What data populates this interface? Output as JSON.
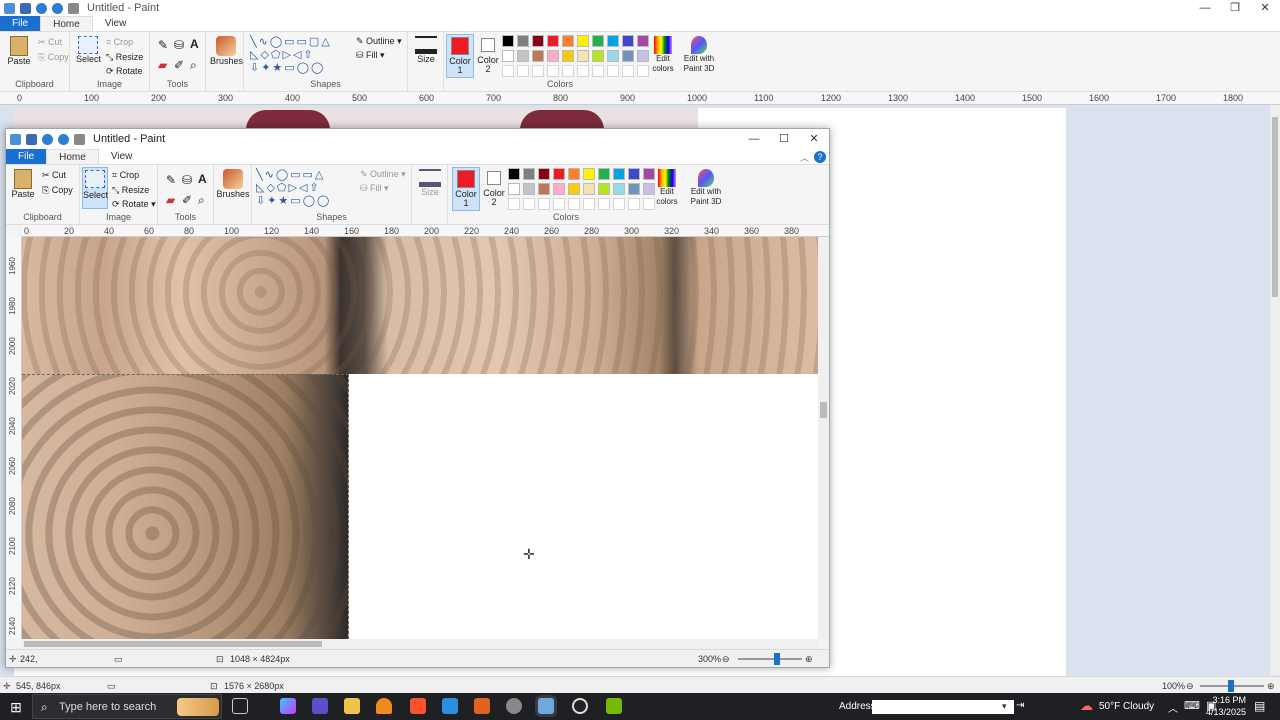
{
  "outer": {
    "title": "Untitled - Paint",
    "tabs": [
      "File",
      "Home",
      "View"
    ],
    "clipboard": {
      "paste": "Paste",
      "cut": "Cut",
      "copy": "Copy",
      "label": "Clipboard"
    },
    "image": {
      "select": "Select",
      "crop": "Crop",
      "resize": "Resize",
      "rotate": "Rotate",
      "label": "Image"
    },
    "tools_label": "Tools",
    "brushes": "Brushes",
    "shapes": {
      "outline": "Outline",
      "fill": "Fill",
      "label": "Shapes"
    },
    "size": "Size",
    "color1": "Color 1",
    "color2": "Color 2",
    "colors_label": "Colors",
    "edit_colors": "Edit colors",
    "edit_3d": "Edit with Paint 3D",
    "ruler": [
      "0",
      "100",
      "200",
      "300",
      "400",
      "500",
      "600",
      "700",
      "800",
      "900",
      "1000",
      "1100",
      "1200",
      "1300",
      "1400",
      "1500",
      "1600",
      "1700",
      "1800"
    ],
    "status_pos": "545, 846px",
    "status_size": "1576 × 2680px",
    "zoom": "100%"
  },
  "inner": {
    "title": "Untitled - Paint",
    "tabs": [
      "File",
      "Home",
      "View"
    ],
    "clipboard": {
      "paste": "Paste",
      "cut": "Cut",
      "copy": "Copy",
      "label": "Clipboard"
    },
    "image": {
      "select": "Select",
      "crop": "Crop",
      "resize": "Resize",
      "rotate": "Rotate",
      "label": "Image"
    },
    "tools_label": "Tools",
    "brushes": "Brushes",
    "shapes": {
      "outline": "Outline",
      "fill": "Fill",
      "label": "Shapes"
    },
    "size": "Size",
    "color1": "Color 1",
    "color2": "Color 2",
    "colors_label": "Colors",
    "edit_colors": "Edit colors",
    "edit_3d": "Edit with Paint 3D",
    "ruler": [
      "0",
      "20",
      "40",
      "60",
      "80",
      "100",
      "120",
      "140",
      "160",
      "180",
      "200",
      "220",
      "240",
      "260",
      "280",
      "300",
      "320",
      "340",
      "360",
      "380"
    ],
    "vruler": [
      "1960",
      "1980",
      "2000",
      "2020",
      "2040",
      "2060",
      "2080",
      "2100",
      "2120",
      "2140"
    ],
    "status_pos": "242,",
    "status_size": "1048 × 4824px",
    "zoom": "300%"
  },
  "palette": [
    "#000000",
    "#7f7f7f",
    "#880015",
    "#ed1c24",
    "#ff7f27",
    "#fff200",
    "#22b14c",
    "#00a2e8",
    "#3f48cc",
    "#a349a4",
    "#ffffff",
    "#c3c3c3",
    "#b97a57",
    "#ffaec9",
    "#ffc90e",
    "#efe4b0",
    "#b5e61d",
    "#99d9ea",
    "#7092be",
    "#c8bfe7"
  ],
  "accent": "#1a6fd1",
  "color1_value": "#ed1c24",
  "taskbar": {
    "search_placeholder": "Type here to search",
    "address_label": "Address",
    "weather": "50°F  Cloudy",
    "time": "3:16 PM",
    "date": "4/13/2025"
  }
}
